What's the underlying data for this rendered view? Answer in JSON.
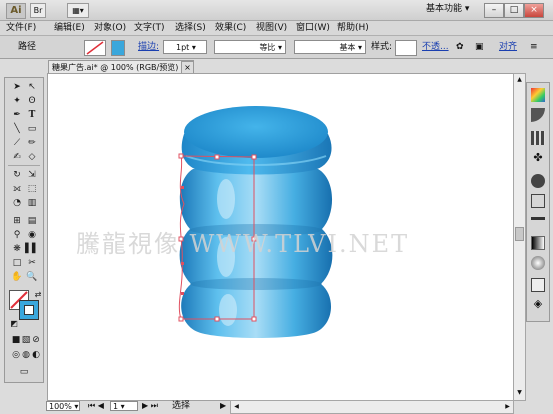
{
  "app": {
    "logo": "Ai",
    "workspace": "基本功能"
  },
  "menu": [
    "文件(F)",
    "编辑(E)",
    "对象(O)",
    "文字(T)",
    "选择(S)",
    "效果(C)",
    "视图(V)",
    "窗口(W)",
    "帮助(H)"
  ],
  "control": {
    "object_type": "路径",
    "stroke_label": "描边:",
    "stroke_weight": "1pt",
    "profile_uniform": "等比",
    "brush_basic": "基本",
    "style_label": "样式:",
    "opacity_label": "不透...",
    "align_label": "对齐"
  },
  "document": {
    "tab_title": "糖果广告.ai* @ 100% (RGB/预览)",
    "tab_close": "×"
  },
  "watermark": "騰龍視像 WWW.TLVI.NET",
  "status": {
    "zoom": "100%",
    "artboard": "1",
    "tool_mode": "选择"
  },
  "icons": {
    "window": [
      "minimize-icon",
      "restore-icon",
      "close-icon"
    ],
    "tools": [
      "selection-tool-icon",
      "direct-selection-tool-icon",
      "magic-wand-tool-icon",
      "lasso-tool-icon",
      "pen-tool-icon",
      "type-tool-icon",
      "line-tool-icon",
      "rectangle-tool-icon",
      "paintbrush-tool-icon",
      "pencil-tool-icon",
      "blob-brush-tool-icon",
      "eraser-tool-icon",
      "rotate-tool-icon",
      "scale-tool-icon",
      "width-tool-icon",
      "free-transform-tool-icon",
      "shape-builder-tool-icon",
      "perspective-grid-tool-icon",
      "mesh-tool-icon",
      "gradient-tool-icon",
      "eyedropper-tool-icon",
      "blend-tool-icon",
      "symbol-sprayer-tool-icon",
      "column-graph-tool-icon",
      "artboard-tool-icon",
      "slice-tool-icon",
      "hand-tool-icon",
      "zoom-tool-icon"
    ],
    "panels": [
      "color-panel-icon",
      "color-guide-panel-icon",
      "swatches-panel-icon",
      "brushes-panel-icon",
      "symbols-panel-icon",
      "graphic-styles-panel-icon",
      "stroke-panel-icon",
      "gradient-panel-icon",
      "transparency-panel-icon",
      "appearance-panel-icon",
      "layers-panel-icon",
      "artboards-panel-icon"
    ]
  },
  "colors": {
    "fill": "#3aa7dc",
    "stroke": "#e0303a",
    "selection": "#e05060"
  }
}
